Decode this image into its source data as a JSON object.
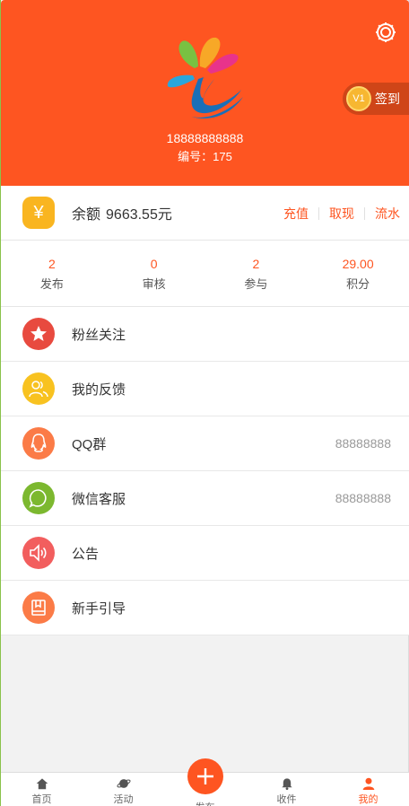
{
  "header": {
    "phone": "18888888888",
    "member_no": "编号：175",
    "checkin": {
      "level": "V1",
      "label": "签到"
    }
  },
  "balance": {
    "label": "余额",
    "amount": "9663.55元",
    "links": [
      "充值",
      "取现",
      "流水"
    ]
  },
  "stats": [
    {
      "value": "2",
      "label": "发布"
    },
    {
      "value": "0",
      "label": "审核"
    },
    {
      "value": "2",
      "label": "参与"
    },
    {
      "value": "29.00",
      "label": "积分"
    }
  ],
  "menu": [
    {
      "label": "粉丝关注",
      "value": "",
      "icon": "star-icon",
      "color": "#e84a3f"
    },
    {
      "label": "我的反馈",
      "value": "",
      "icon": "users-icon",
      "color": "#f8c220"
    },
    {
      "label": "QQ群",
      "value": "88888888",
      "icon": "qq-icon",
      "color": "#fb7b47"
    },
    {
      "label": "微信客服",
      "value": "88888888",
      "icon": "wechat-icon",
      "color": "#7cb82f"
    },
    {
      "label": "公告",
      "value": "",
      "icon": "speaker-icon",
      "color": "#f25e5e"
    },
    {
      "label": "新手引导",
      "value": "",
      "icon": "book-icon",
      "color": "#fb7b47"
    }
  ],
  "nav": [
    {
      "label": "首页",
      "icon": "home-icon"
    },
    {
      "label": "活动",
      "icon": "planet-icon"
    },
    {
      "label": "发布",
      "icon": "plus-icon"
    },
    {
      "label": "收件",
      "icon": "bell-icon"
    },
    {
      "label": "我的",
      "icon": "user-icon"
    }
  ],
  "colors": {
    "brand": "#fe5521",
    "background": "#f2f2f2"
  }
}
